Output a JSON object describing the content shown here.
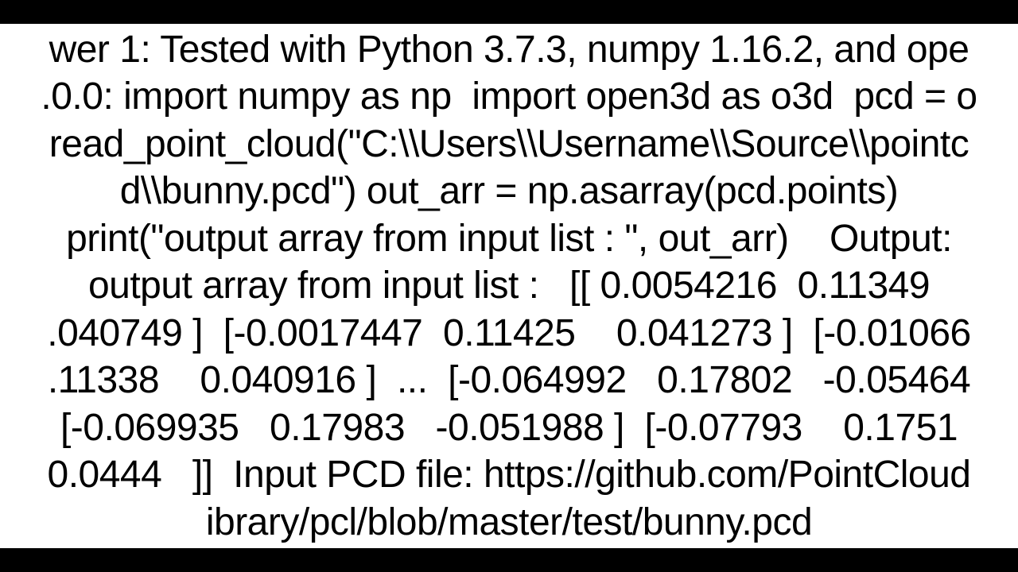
{
  "answer": {
    "line1": "wer 1: Tested with Python 3.7.3, numpy 1.16.2, and ope",
    "line2": ".0.0: import numpy as np  import open3d as o3d  pcd = o",
    "line3": "read_point_cloud(\"C:\\\\Users\\\\Username\\\\Source\\\\pointc",
    "line4": "d\\\\bunny.pcd\") out_arr = np.asarray(pcd.points)",
    "line5": "print(\"output array from input list : \", out_arr)    Output:",
    "line6": "output array from input list :   [[ 0.0054216  0.11349",
    "line7": ".040749 ]  [-0.0017447  0.11425    0.041273 ]  [-0.01066",
    "line8": ".11338    0.040916 ]  ...  [-0.064992   0.17802   -0.05464",
    "line9": "[-0.069935   0.17983   -0.051988 ]  [-0.07793    0.1751",
    "line10": "0.0444   ]]  Input PCD file: https://github.com/PointCloud",
    "line11": "ibrary/pcl/blob/master/test/bunny.pcd"
  }
}
